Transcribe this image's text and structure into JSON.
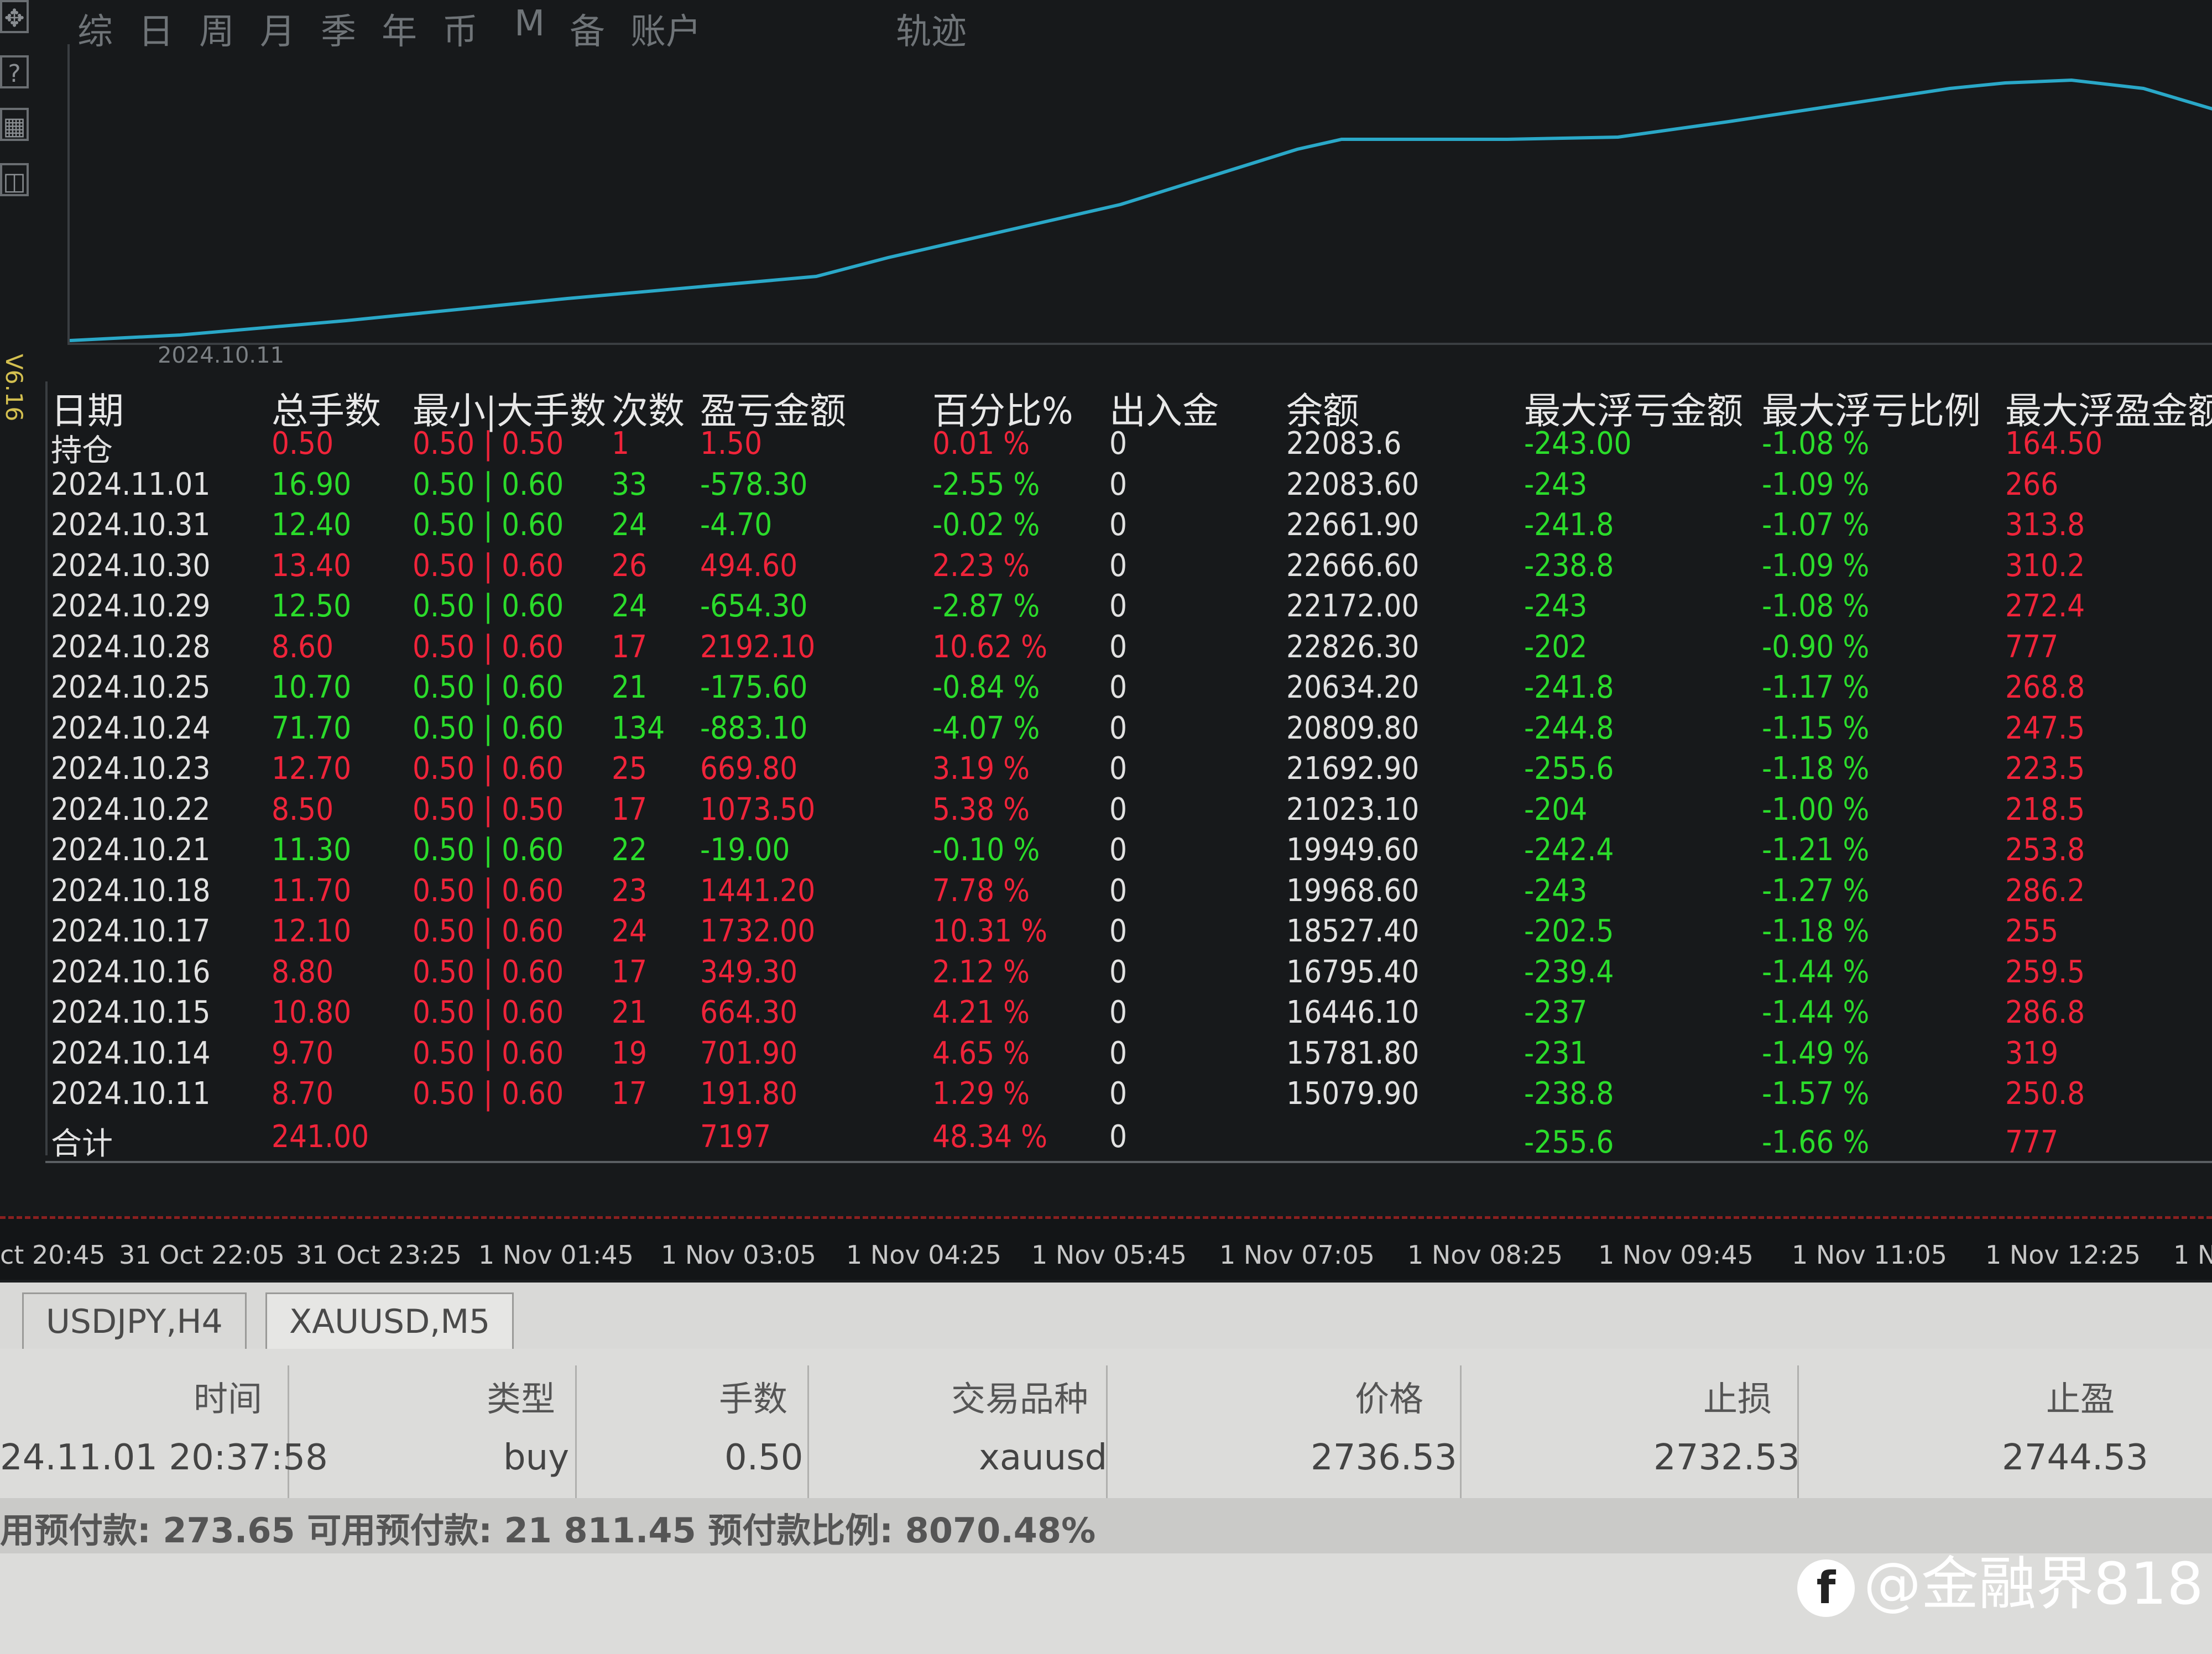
{
  "period_tabs": [
    "综",
    "日",
    "周",
    "月",
    "季",
    "年",
    "币",
    "M",
    "备",
    "账户",
    "轨迹"
  ],
  "toolbar": {
    "icons": [
      "move-icon",
      "help-icon",
      "chart-icon",
      "window-icon"
    ],
    "version": "V6.16"
  },
  "chart": {
    "date_label": "2024.10.11",
    "line_color": "#2aa8c8"
  },
  "stats": {
    "headers": [
      "日期",
      "总手数",
      "最小|大手数",
      "次数",
      "盈亏金额",
      "百分比%",
      "出入金",
      "余额",
      "最大浮亏金额",
      "最大浮亏比例",
      "最大浮盈金额"
    ],
    "rows": [
      {
        "date": "持仓",
        "lots": "0.50",
        "minmax": "0.50 | 0.50",
        "count": "1",
        "pnl": "1.50",
        "pct": "0.01 %",
        "io": "0",
        "balance": "22083.6",
        "maxloss": "-243.00",
        "maxloss_pct": "-1.08 %",
        "maxprofit": "164.50",
        "sign": "red"
      },
      {
        "date": "2024.11.01",
        "lots": "16.90",
        "minmax": "0.50 | 0.60",
        "count": "33",
        "pnl": "-578.30",
        "pct": "-2.55 %",
        "io": "0",
        "balance": "22083.60",
        "maxloss": "-243",
        "maxloss_pct": "-1.09 %",
        "maxprofit": "266",
        "sign": "green"
      },
      {
        "date": "2024.10.31",
        "lots": "12.40",
        "minmax": "0.50 | 0.60",
        "count": "24",
        "pnl": "-4.70",
        "pct": "-0.02 %",
        "io": "0",
        "balance": "22661.90",
        "maxloss": "-241.8",
        "maxloss_pct": "-1.07 %",
        "maxprofit": "313.8",
        "sign": "green"
      },
      {
        "date": "2024.10.30",
        "lots": "13.40",
        "minmax": "0.50 | 0.60",
        "count": "26",
        "pnl": "494.60",
        "pct": "2.23 %",
        "io": "0",
        "balance": "22666.60",
        "maxloss": "-238.8",
        "maxloss_pct": "-1.09 %",
        "maxprofit": "310.2",
        "sign": "red"
      },
      {
        "date": "2024.10.29",
        "lots": "12.50",
        "minmax": "0.50 | 0.60",
        "count": "24",
        "pnl": "-654.30",
        "pct": "-2.87 %",
        "io": "0",
        "balance": "22172.00",
        "maxloss": "-243",
        "maxloss_pct": "-1.08 %",
        "maxprofit": "272.4",
        "sign": "green"
      },
      {
        "date": "2024.10.28",
        "lots": "8.60",
        "minmax": "0.50 | 0.60",
        "count": "17",
        "pnl": "2192.10",
        "pct": "10.62 %",
        "io": "0",
        "balance": "22826.30",
        "maxloss": "-202",
        "maxloss_pct": "-0.90 %",
        "maxprofit": "777",
        "sign": "red"
      },
      {
        "date": "2024.10.25",
        "lots": "10.70",
        "minmax": "0.50 | 0.60",
        "count": "21",
        "pnl": "-175.60",
        "pct": "-0.84 %",
        "io": "0",
        "balance": "20634.20",
        "maxloss": "-241.8",
        "maxloss_pct": "-1.17 %",
        "maxprofit": "268.8",
        "sign": "green"
      },
      {
        "date": "2024.10.24",
        "lots": "71.70",
        "minmax": "0.50 | 0.60",
        "count": "134",
        "pnl": "-883.10",
        "pct": "-4.07 %",
        "io": "0",
        "balance": "20809.80",
        "maxloss": "-244.8",
        "maxloss_pct": "-1.15 %",
        "maxprofit": "247.5",
        "sign": "green"
      },
      {
        "date": "2024.10.23",
        "lots": "12.70",
        "minmax": "0.50 | 0.60",
        "count": "25",
        "pnl": "669.80",
        "pct": "3.19 %",
        "io": "0",
        "balance": "21692.90",
        "maxloss": "-255.6",
        "maxloss_pct": "-1.18 %",
        "maxprofit": "223.5",
        "sign": "red"
      },
      {
        "date": "2024.10.22",
        "lots": "8.50",
        "minmax": "0.50 | 0.50",
        "count": "17",
        "pnl": "1073.50",
        "pct": "5.38 %",
        "io": "0",
        "balance": "21023.10",
        "maxloss": "-204",
        "maxloss_pct": "-1.00 %",
        "maxprofit": "218.5",
        "sign": "red"
      },
      {
        "date": "2024.10.21",
        "lots": "11.30",
        "minmax": "0.50 | 0.60",
        "count": "22",
        "pnl": "-19.00",
        "pct": "-0.10 %",
        "io": "0",
        "balance": "19949.60",
        "maxloss": "-242.4",
        "maxloss_pct": "-1.21 %",
        "maxprofit": "253.8",
        "sign": "green"
      },
      {
        "date": "2024.10.18",
        "lots": "11.70",
        "minmax": "0.50 | 0.60",
        "count": "23",
        "pnl": "1441.20",
        "pct": "7.78 %",
        "io": "0",
        "balance": "19968.60",
        "maxloss": "-243",
        "maxloss_pct": "-1.27 %",
        "maxprofit": "286.2",
        "sign": "red"
      },
      {
        "date": "2024.10.17",
        "lots": "12.10",
        "minmax": "0.50 | 0.60",
        "count": "24",
        "pnl": "1732.00",
        "pct": "10.31 %",
        "io": "0",
        "balance": "18527.40",
        "maxloss": "-202.5",
        "maxloss_pct": "-1.18 %",
        "maxprofit": "255",
        "sign": "red"
      },
      {
        "date": "2024.10.16",
        "lots": "8.80",
        "minmax": "0.50 | 0.60",
        "count": "17",
        "pnl": "349.30",
        "pct": "2.12 %",
        "io": "0",
        "balance": "16795.40",
        "maxloss": "-239.4",
        "maxloss_pct": "-1.44 %",
        "maxprofit": "259.5",
        "sign": "red"
      },
      {
        "date": "2024.10.15",
        "lots": "10.80",
        "minmax": "0.50 | 0.60",
        "count": "21",
        "pnl": "664.30",
        "pct": "4.21 %",
        "io": "0",
        "balance": "16446.10",
        "maxloss": "-237",
        "maxloss_pct": "-1.44 %",
        "maxprofit": "286.8",
        "sign": "red"
      },
      {
        "date": "2024.10.14",
        "lots": "9.70",
        "minmax": "0.50 | 0.60",
        "count": "19",
        "pnl": "701.90",
        "pct": "4.65 %",
        "io": "0",
        "balance": "15781.80",
        "maxloss": "-231",
        "maxloss_pct": "-1.49 %",
        "maxprofit": "319",
        "sign": "red"
      },
      {
        "date": "2024.10.11",
        "lots": "8.70",
        "minmax": "0.50 | 0.60",
        "count": "17",
        "pnl": "191.80",
        "pct": "1.29 %",
        "io": "0",
        "balance": "15079.90",
        "maxloss": "-238.8",
        "maxloss_pct": "-1.57 %",
        "maxprofit": "250.8",
        "sign": "red"
      }
    ],
    "total": {
      "label": "合计",
      "lots": "241.00",
      "pnl": "7197",
      "pct": "48.34 %",
      "io": "0",
      "maxloss": "-255.6",
      "maxloss_pct": "-1.66 %",
      "maxprofit": "777"
    }
  },
  "timeline": [
    "ct 20:45",
    "31 Oct 22:05",
    "31 Oct 23:25",
    "1 Nov 01:45",
    "1 Nov 03:05",
    "1 Nov 04:25",
    "1 Nov 05:45",
    "1 Nov 07:05",
    "1 Nov 08:25",
    "1 Nov 09:45",
    "1 Nov 11:05",
    "1 Nov 12:25",
    "1 N"
  ],
  "chart_tabs": [
    "USDJPY,H4",
    "XAUUSD,M5"
  ],
  "orders": {
    "headers": [
      "时间",
      "类型",
      "手数",
      "交易品种",
      "价格",
      "止损",
      "止盈"
    ],
    "row": [
      "24.11.01 20:37:58",
      "buy",
      "0.50",
      "xauusd",
      "2736.53",
      "2732.53",
      "2744.53"
    ],
    "balance_text": "用预付款: 273.65  可用预付款: 21 811.45  预付款比例: 8070.48%"
  },
  "watermark": {
    "logo": "f",
    "text": "@金融界818"
  },
  "colors": {
    "profit": "#f0243a",
    "loss": "#2bdc2b",
    "equity_line": "#2aa8c8"
  }
}
